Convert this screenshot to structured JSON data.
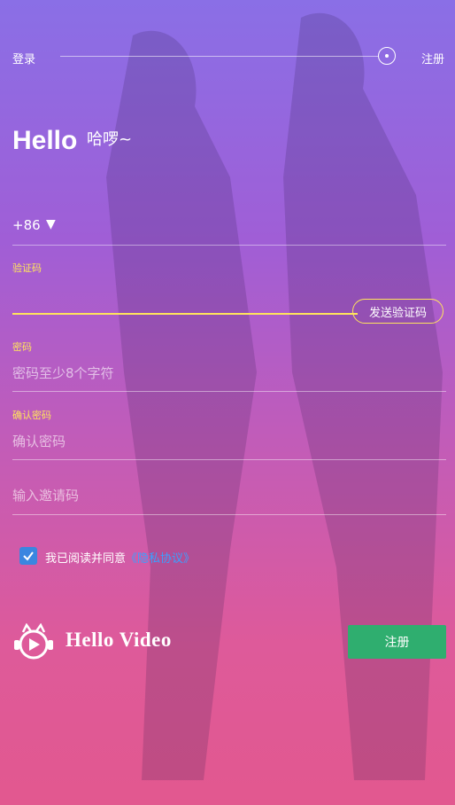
{
  "top": {
    "login": "登录",
    "register": "注册"
  },
  "greeting": {
    "title": "Hello",
    "subtitle": "哈啰~"
  },
  "phone": {
    "country_code": "+86",
    "caret": "▼"
  },
  "verification": {
    "label": "验证码",
    "value": "",
    "send_button": "发送验证码"
  },
  "password": {
    "label": "密码",
    "placeholder": "密码至少8个字符"
  },
  "confirm_password": {
    "label": "确认密码",
    "placeholder": "确认密码"
  },
  "invite": {
    "placeholder": "输入邀请码"
  },
  "agreement": {
    "checked": true,
    "text": "我已阅读并同意",
    "link": "《隐私协议》"
  },
  "brand": {
    "name": "Hello Video"
  },
  "actions": {
    "register": "注册"
  },
  "colors": {
    "accent_yellow": "#ffe45c",
    "register_green": "#2fae6f",
    "link_blue": "#3aa0ff",
    "checkbox_blue": "#3a86e0"
  }
}
